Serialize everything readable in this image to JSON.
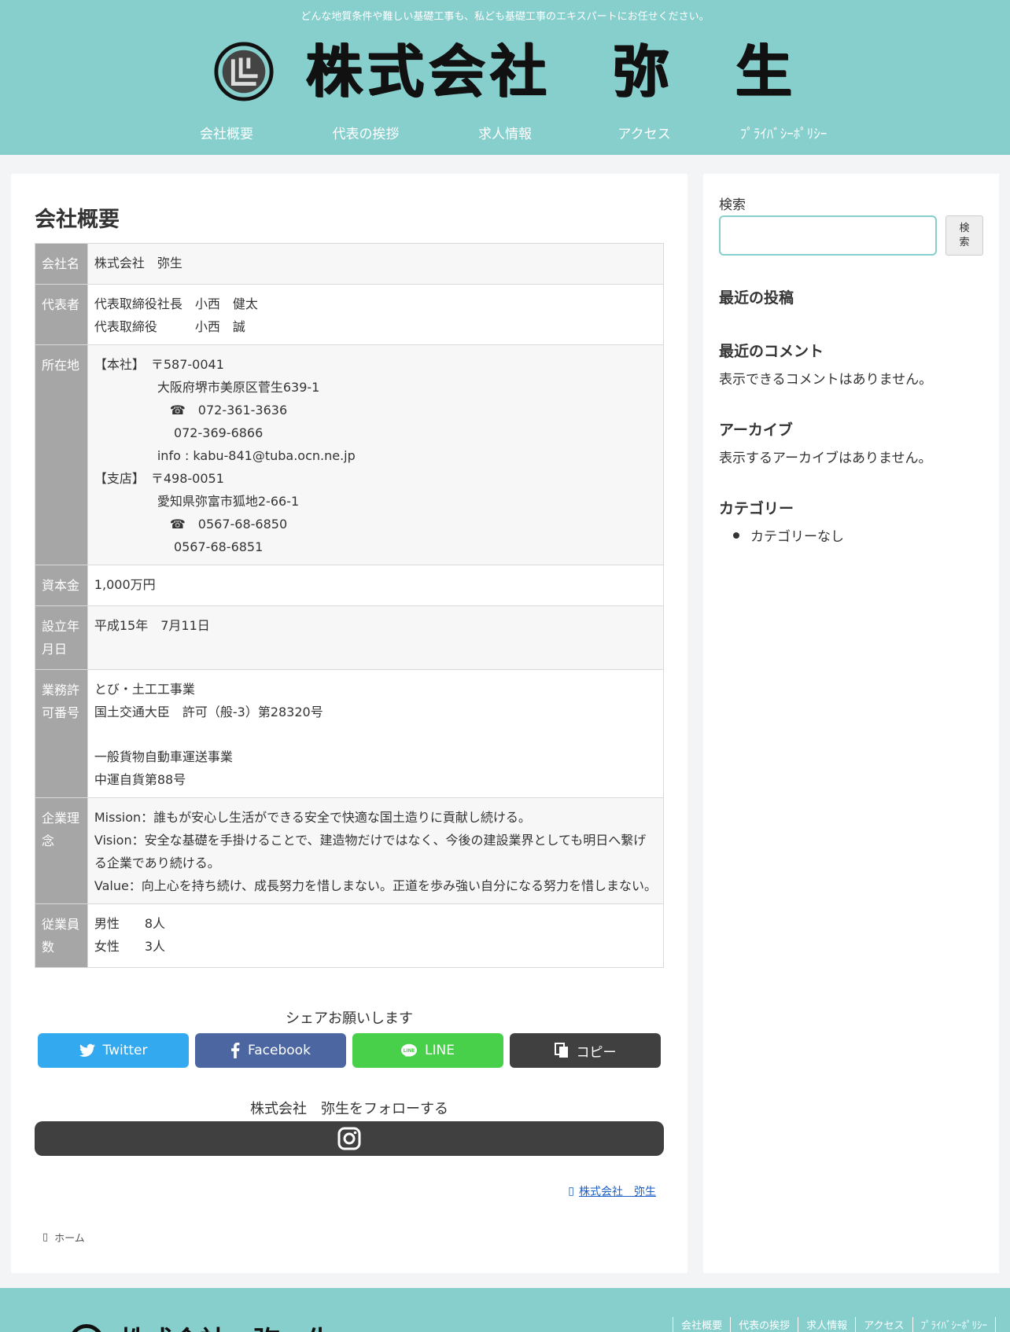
{
  "header": {
    "tagline": "どんな地質条件や難しい基礎工事も、私ども基礎工事のエキスパートにお任せください。",
    "logo_text": "株式会社　弥　生",
    "nav": [
      "会社概要",
      "代表の挨拶",
      "求人情報",
      "アクセス",
      "ﾌﾟﾗｲﾊﾞｼｰﾎﾟﾘｼｰ"
    ]
  },
  "page": {
    "title": "会社概要",
    "rows": [
      {
        "label": "会社名",
        "lines": [
          "株式会社　弥生"
        ]
      },
      {
        "label": "代表者",
        "lines": [
          "代表取締役社長　小西　健太",
          "代表取締役　　　小西　誠"
        ]
      },
      {
        "label": "所在地",
        "lines": [
          "【本社】　〒587-0041",
          "　　　　　大阪府堺市美原区菅生639-1",
          "　　　　　　☎　072-361-3636",
          "　　　　　　 072-369-6866",
          "　　　　　info : kabu-841@tuba.ocn.ne.jp",
          "【支店】　〒498-0051",
          "　　　　　愛知県弥富市狐地2-66-1",
          "　　　　　　☎　0567-68-6850",
          "　　　　　　 0567-68-6851"
        ]
      },
      {
        "label": "資本金",
        "lines": [
          "1,000万円"
        ]
      },
      {
        "label": "設立年月日",
        "lines": [
          "平成15年　7月11日"
        ]
      },
      {
        "label": "業務許可番号",
        "lines": [
          "とび・土工工事業",
          "国土交通大臣　許可（般-3）第28320号",
          "",
          "一般貨物自動車運送事業",
          "中運自貨第88号"
        ]
      },
      {
        "label": "企業理念",
        "lines": [
          "Mission：誰もが安心し生活ができる安全で快適な国土造りに貢献し続ける。",
          "Vision：安全な基礎を手掛けることで、建造物だけではなく、今後の建設業界としても明日へ繋げる企業であり続ける。",
          "Value：向上心を持ち続け、成長努力を惜しまない。正道を歩み強い自分になる努力を惜しまない。"
        ]
      },
      {
        "label": "従業員数",
        "lines": [
          "男性　　8人",
          "女性　　3人"
        ]
      }
    ]
  },
  "share": {
    "title": "シェアお願いします",
    "buttons": [
      "Twitter",
      "Facebook",
      "LINE",
      "コピー"
    ]
  },
  "follow": {
    "title": "株式会社　弥生をフォローする"
  },
  "author": {
    "name": "株式会社　弥生"
  },
  "breadcrumb": {
    "home": "ホーム"
  },
  "sidebar": {
    "search_label": "検索",
    "search_button": "検索",
    "recent_posts": "最近の投稿",
    "recent_comments": "最近のコメント",
    "no_comments": "表示できるコメントはありません。",
    "archives": "アーカイブ",
    "no_archives": "表示するアーカイブはありません。",
    "categories": "カテゴリー",
    "no_categories": "カテゴリーなし"
  },
  "footer": {
    "nav": [
      "会社概要",
      "代表の挨拶",
      "求人情報",
      "アクセス",
      "ﾌﾟﾗｲﾊﾞｼｰﾎﾟﾘｼｰ"
    ],
    "logo_text": "株式会社　弥　生"
  },
  "colors": {
    "header": "#86cfcd",
    "twitter": "#33a9ef",
    "facebook": "#4b66a1",
    "line": "#48d04b",
    "copy": "#404040"
  }
}
